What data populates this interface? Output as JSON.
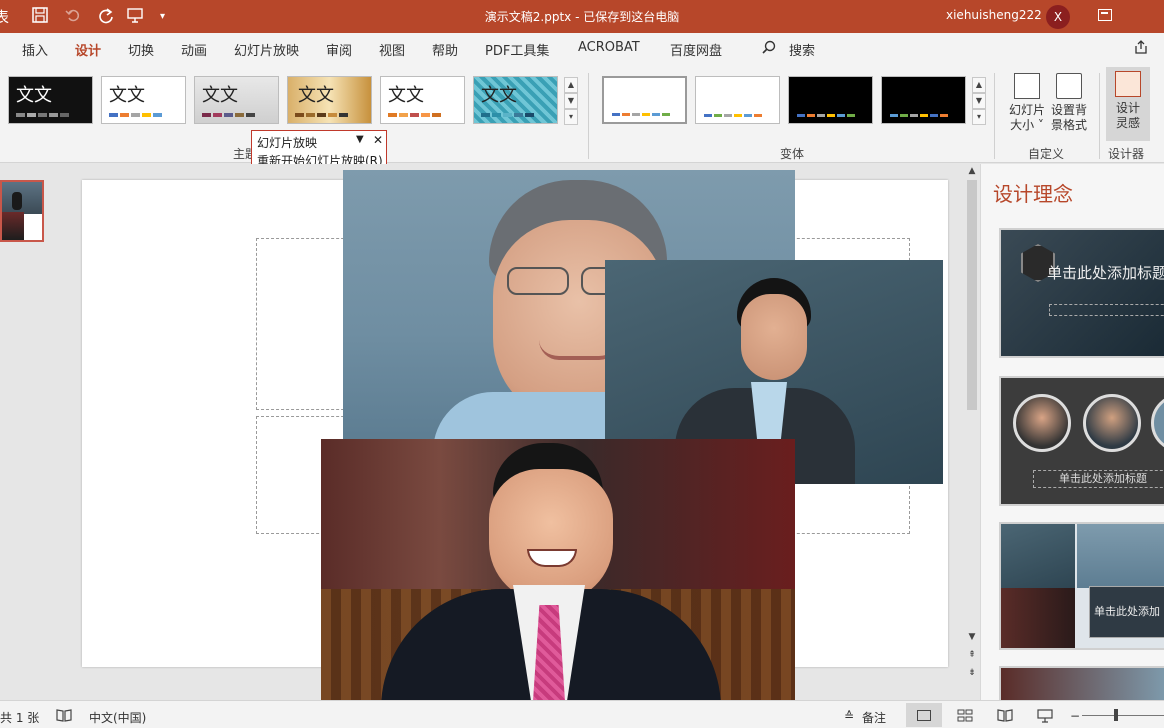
{
  "titlebar": {
    "app_fragment": "表",
    "doc_title": "演示文稿2.pptx - 已保存到这台电脑",
    "user": "xiehuisheng222",
    "avatar_letter": "X"
  },
  "tabs": [
    "插入",
    "设计",
    "切换",
    "动画",
    "幻灯片放映",
    "审阅",
    "视图",
    "帮助",
    "PDF工具集",
    "ACROBAT",
    "百度网盘",
    "搜索"
  ],
  "active_tab": "设计",
  "ribbon": {
    "theme_label": "文文",
    "group_theme_fragment": "主题",
    "group_variants": "变体",
    "group_customize": "自定义",
    "group_designer": "设计器",
    "slide_size": "幻灯片\n大小 ˅",
    "format_bg": "设置背\n景格式",
    "design_ideas_btn": "设计\n灵感"
  },
  "popup": {
    "title": "幻灯片放映",
    "item": "重新开始幻灯片放映(R)"
  },
  "right_pane": {
    "title": "设计理念",
    "design1_text": "单击此处添加标题",
    "design2_text": "单击此处添加标题",
    "design3_text": "单击此处添加"
  },
  "status": {
    "slide_count": "共 1 张",
    "language": "中文(中国)",
    "notes": "备注"
  },
  "colors": {
    "accent": "#b7472a"
  }
}
